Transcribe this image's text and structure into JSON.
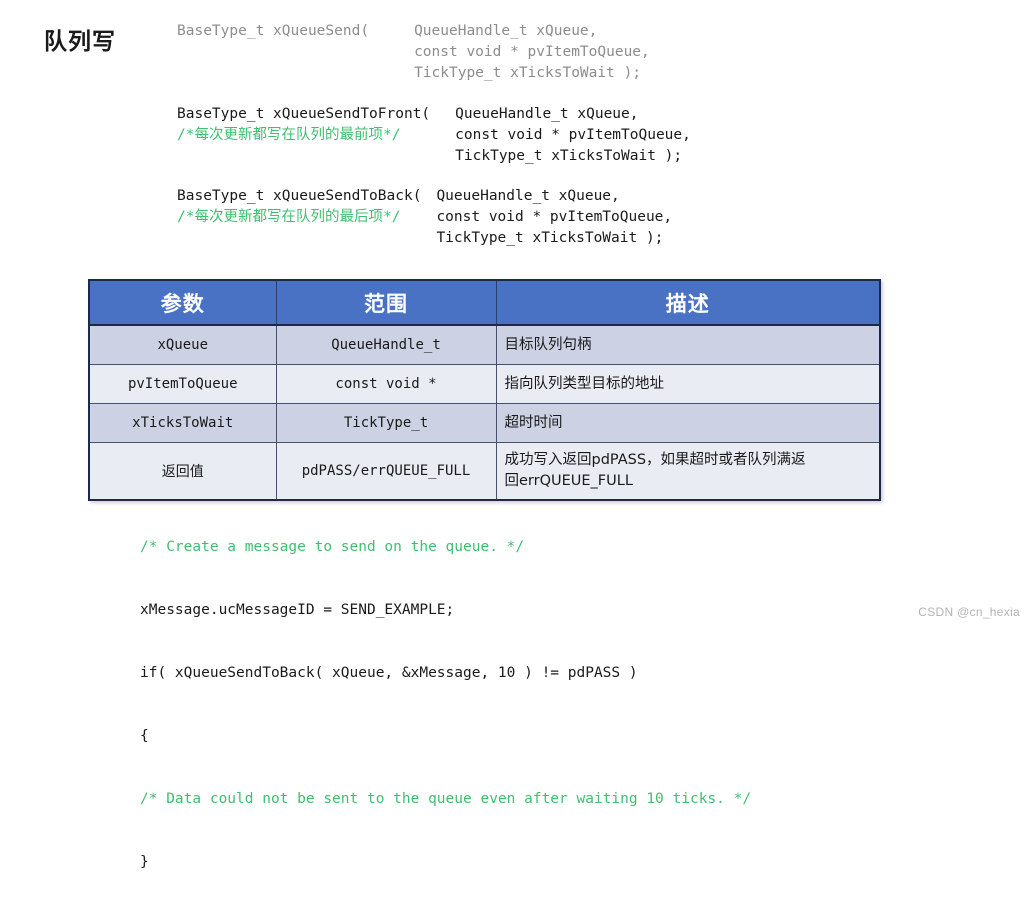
{
  "slide": {
    "title": "队列写"
  },
  "signatures": [
    {
      "id": "sig-block-1",
      "color": "gray",
      "left_lines": [
        "BaseType_t xQueueSend("
      ],
      "left_comment": "",
      "right_lines": [
        "QueueHandle_t xQueue,",
        "const void * pvItemToQueue,",
        "TickType_t xTicksToWait );"
      ]
    },
    {
      "id": "sig-block-2",
      "color": "black",
      "left_lines": [
        "BaseType_t xQueueSendToFront("
      ],
      "left_comment": "/*每次更新都写在队列的最前项*/",
      "right_lines": [
        "QueueHandle_t xQueue,",
        "const void * pvItemToQueue,",
        "TickType_t xTicksToWait );"
      ]
    },
    {
      "id": "sig-block-3",
      "color": "black",
      "left_lines": [
        "BaseType_t xQueueSendToBack("
      ],
      "left_comment": "/*每次更新都写在队列的最后项*/",
      "right_lines": [
        "QueueHandle_t xQueue,",
        "const void * pvItemToQueue,",
        "TickType_t xTicksToWait );"
      ]
    }
  ],
  "table": {
    "headers": [
      "参数",
      "范围",
      "描述"
    ],
    "rows": [
      {
        "param": "xQueue",
        "range": "QueueHandle_t",
        "desc_lines": [
          "目标队列句柄"
        ]
      },
      {
        "param": "pvItemToQueue",
        "range": "const void *",
        "desc_lines": [
          "指向队列类型目标的地址"
        ]
      },
      {
        "param": "xTicksToWait",
        "range": "TickType_t",
        "desc_lines": [
          "超时时间"
        ]
      },
      {
        "param": "返回值",
        "range": "pdPASS/errQUEUE_FULL",
        "desc_lines": [
          "成功写入返回pdPASS，如果超时或者队列满返",
          "回errQUEUE_FULL"
        ]
      }
    ],
    "colors": {
      "header_bg": "#4a72c4",
      "header_text": "#ffffff",
      "row_a_bg": "#ccd2e4",
      "row_b_bg": "#e9ecf3",
      "border": "#1b2a4a"
    }
  },
  "example": {
    "lines": [
      {
        "text": "/* Create a message to send on the queue. */",
        "color": "green"
      },
      {
        "text": "xMessage.ucMessageID = SEND_EXAMPLE;",
        "color": "black"
      },
      {
        "text": "if( xQueueSendToBack( xQueue, &xMessage, 10 ) != pdPASS )",
        "color": "black"
      },
      {
        "text": "{",
        "color": "black"
      },
      {
        "text": "/* Data could not be sent to the queue even after waiting 10 ticks. */",
        "color": "green"
      },
      {
        "text": "}",
        "color": "black"
      }
    ]
  },
  "watermark": {
    "text": "CSDN @cn_hexia"
  }
}
